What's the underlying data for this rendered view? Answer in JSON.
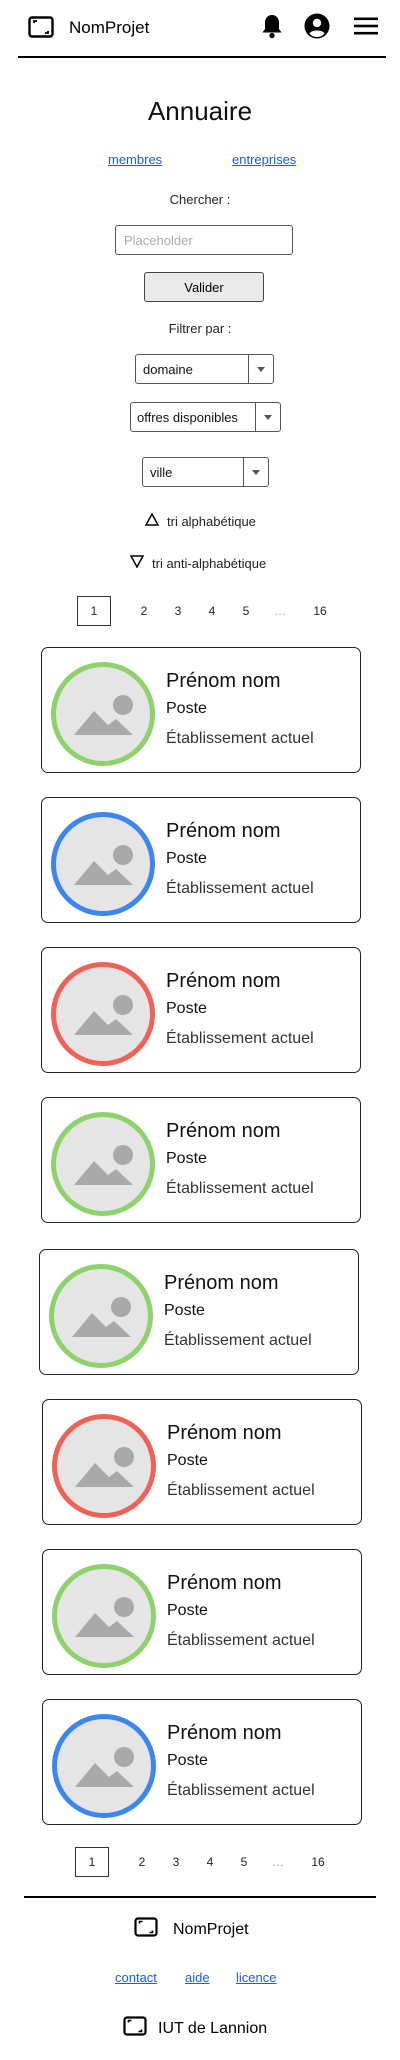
{
  "header": {
    "app_name": "NomProjet",
    "logo_icon": "image-frame-icon",
    "notification_icon": "bell-icon",
    "account_icon": "user-circle-icon",
    "menu_icon": "hamburger-menu-icon"
  },
  "page": {
    "title": "Annuaire",
    "tabs": [
      "membres",
      "entreprises"
    ]
  },
  "search": {
    "label": "Chercher :",
    "placeholder": "Placeholder",
    "submit_label": "Valider"
  },
  "filters": {
    "label": "Filtrer par :",
    "selects": [
      {
        "value": "domaine"
      },
      {
        "value": "offres disponibles"
      },
      {
        "value": "ville"
      }
    ]
  },
  "sort": {
    "asc_label": "tri alphabétique",
    "desc_label": "tri anti-alphabétique"
  },
  "pagination": {
    "current": "1",
    "pages": [
      "2",
      "3",
      "4",
      "5"
    ],
    "ellipsis": "…",
    "last": "16"
  },
  "cards": [
    {
      "name": "Prénom nom",
      "role": "Poste",
      "company": "Établissement actuel",
      "ring_color": "#8dd26a"
    },
    {
      "name": "Prénom nom",
      "role": "Poste",
      "company": "Établissement actuel",
      "ring_color": "#3c86f0"
    },
    {
      "name": "Prénom nom",
      "role": "Poste",
      "company": "Établissement actuel",
      "ring_color": "#f06158"
    },
    {
      "name": "Prénom nom",
      "role": "Poste",
      "company": "Établissement actuel",
      "ring_color": "#8dd26a"
    },
    {
      "name": "Prénom nom",
      "role": "Poste",
      "company": "Établissement actuel",
      "ring_color": "#8dd26a"
    },
    {
      "name": "Prénom nom",
      "role": "Poste",
      "company": "Établissement actuel",
      "ring_color": "#f06158"
    },
    {
      "name": "Prénom nom",
      "role": "Poste",
      "company": "Établissement actuel",
      "ring_color": "#8dd26a"
    },
    {
      "name": "Prénom nom",
      "role": "Poste",
      "company": "Établissement actuel",
      "ring_color": "#3c86f0"
    }
  ],
  "footer": {
    "app_name": "NomProjet",
    "links": [
      "contact",
      "aide",
      "licence"
    ],
    "org_name": "IUT de Lannion"
  }
}
